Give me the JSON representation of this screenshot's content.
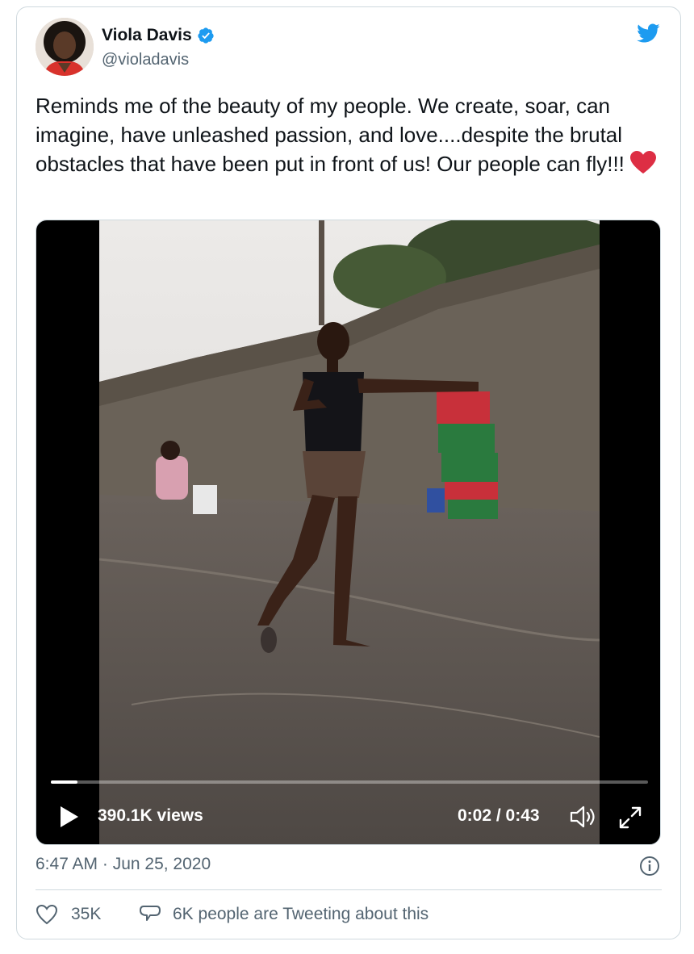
{
  "tweet": {
    "author_name": "Viola Davis",
    "author_handle": "@violadavis",
    "verified": true,
    "text": "Reminds me of the beauty of my people. We create, soar, can imagine, have unleashed passion, and love....despite the brutal obstacles that have been put in front of us! Our people can fly!!!",
    "emoji": "heart-emoji",
    "timestamp": "6:47 AM · Jun 25, 2020",
    "likes": "35K",
    "conversation": "6K people are Tweeting about this"
  },
  "video": {
    "views": "390.1K views",
    "time": "0:02 / 0:43",
    "progress": 0.045
  },
  "colors": {
    "accent": "#1d9bf0",
    "text_secondary": "#536471",
    "heart": "#e0245e",
    "border": "#cfd9de"
  }
}
